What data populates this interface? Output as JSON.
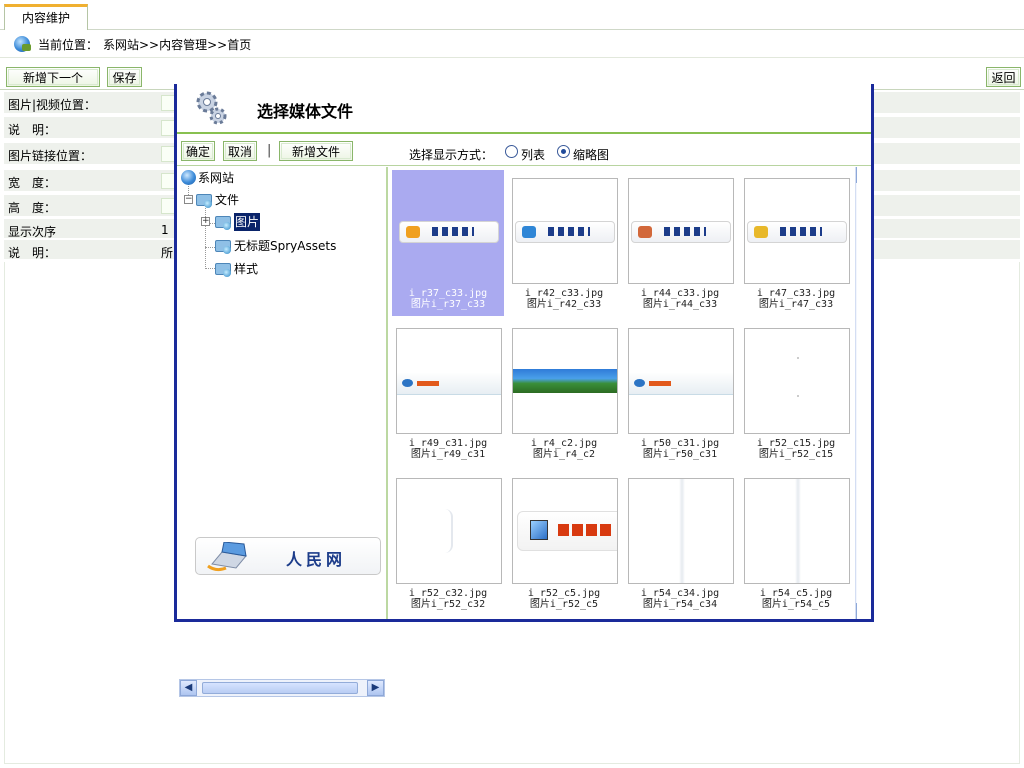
{
  "tab": {
    "label": "内容维护"
  },
  "breadcrumb": {
    "label": "当前位置：",
    "path": "系网站>>内容管理>>首页"
  },
  "toolbar": {
    "add_next": "新增下一个",
    "save": "保存",
    "back": "返回"
  },
  "form": {
    "rows": [
      {
        "label": "图片|视频位置："
      },
      {
        "label": "说　明："
      },
      {
        "label": "图片链接位置："
      },
      {
        "label": "宽　度："
      },
      {
        "label": "高　度："
      },
      {
        "label": "显示次序",
        "value": "1"
      },
      {
        "label": "说　明：",
        "value": "所"
      }
    ]
  },
  "dialog": {
    "title": "选择媒体文件",
    "buttons": {
      "ok": "确定",
      "cancel": "取消",
      "separator": "|",
      "new_file": "新增文件"
    },
    "display_mode": {
      "label": "选择显示方式：",
      "options": [
        "列表",
        "缩略图"
      ],
      "selected": "缩略图"
    },
    "tree": {
      "root": "系网站",
      "folder": "文件",
      "children": [
        "图片",
        "无标题SpryAssets",
        "样式"
      ],
      "selected": "图片"
    },
    "preview": {
      "text": "人民网"
    },
    "files": [
      {
        "name": "i_r37_c33.jpg",
        "title": "图片i_r37_c33",
        "selected": true
      },
      {
        "name": "i_r42_c33.jpg",
        "title": "图片i_r42_c33"
      },
      {
        "name": "i_r44_c33.jpg",
        "title": "图片i_r44_c33"
      },
      {
        "name": "i_r47_c33.jpg",
        "title": "图片i_r47_c33"
      },
      {
        "name": "i_r49_c31.jpg",
        "title": "图片i_r49_c31"
      },
      {
        "name": "i_r4_c2.jpg",
        "title": "图片i_r4_c2"
      },
      {
        "name": "i_r50_c31.jpg",
        "title": "图片i_r50_c31"
      },
      {
        "name": "i_r52_c15.jpg",
        "title": "图片i_r52_c15"
      },
      {
        "name": "i_r52_c32.jpg",
        "title": "图片i_r52_c32"
      },
      {
        "name": "i_r52_c5.jpg",
        "title": "图片i_r52_c5"
      },
      {
        "name": "i_r54_c34.jpg",
        "title": "图片i_r54_c34"
      },
      {
        "name": "i_r54_c5.jpg",
        "title": "图片i_r54_c5"
      }
    ]
  },
  "colors": {
    "dialog_border": "#1a2a9a",
    "accent_green": "#88c050",
    "selection": "#aaaaf0",
    "tab_top": "#f0b030"
  }
}
